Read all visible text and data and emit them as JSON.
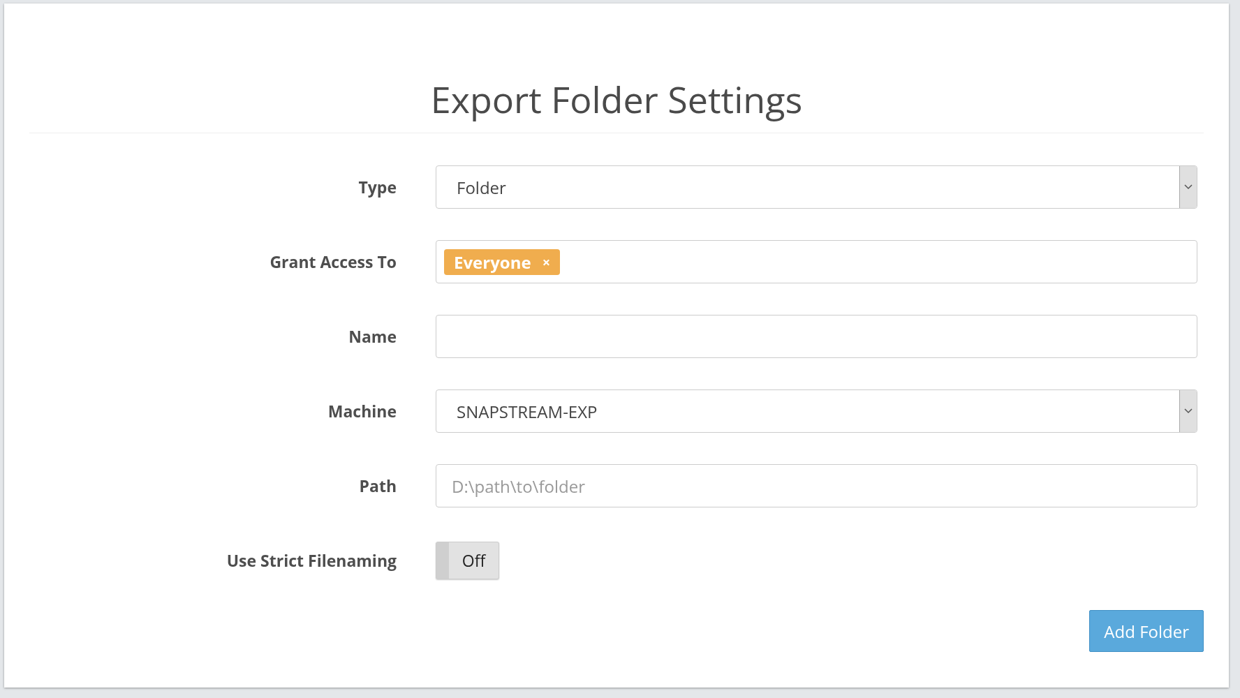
{
  "title": "Export Folder Settings",
  "fields": [
    {
      "kind": "select",
      "label": "Type",
      "value": "Folder"
    },
    {
      "kind": "tags",
      "label": "Grant Access To",
      "tags": [
        {
          "text": "Everyone",
          "remove": "×"
        }
      ]
    },
    {
      "kind": "text",
      "label": "Name"
    },
    {
      "kind": "select",
      "label": "Machine",
      "value": "SNAPSTREAM-EXP"
    },
    {
      "kind": "text",
      "label": "Path",
      "placeholder": "D:\\path\\to\\folder"
    },
    {
      "kind": "toggle",
      "label": "Use Strict Filenaming",
      "on": false,
      "text": "Off"
    }
  ],
  "button": "Add Folder"
}
